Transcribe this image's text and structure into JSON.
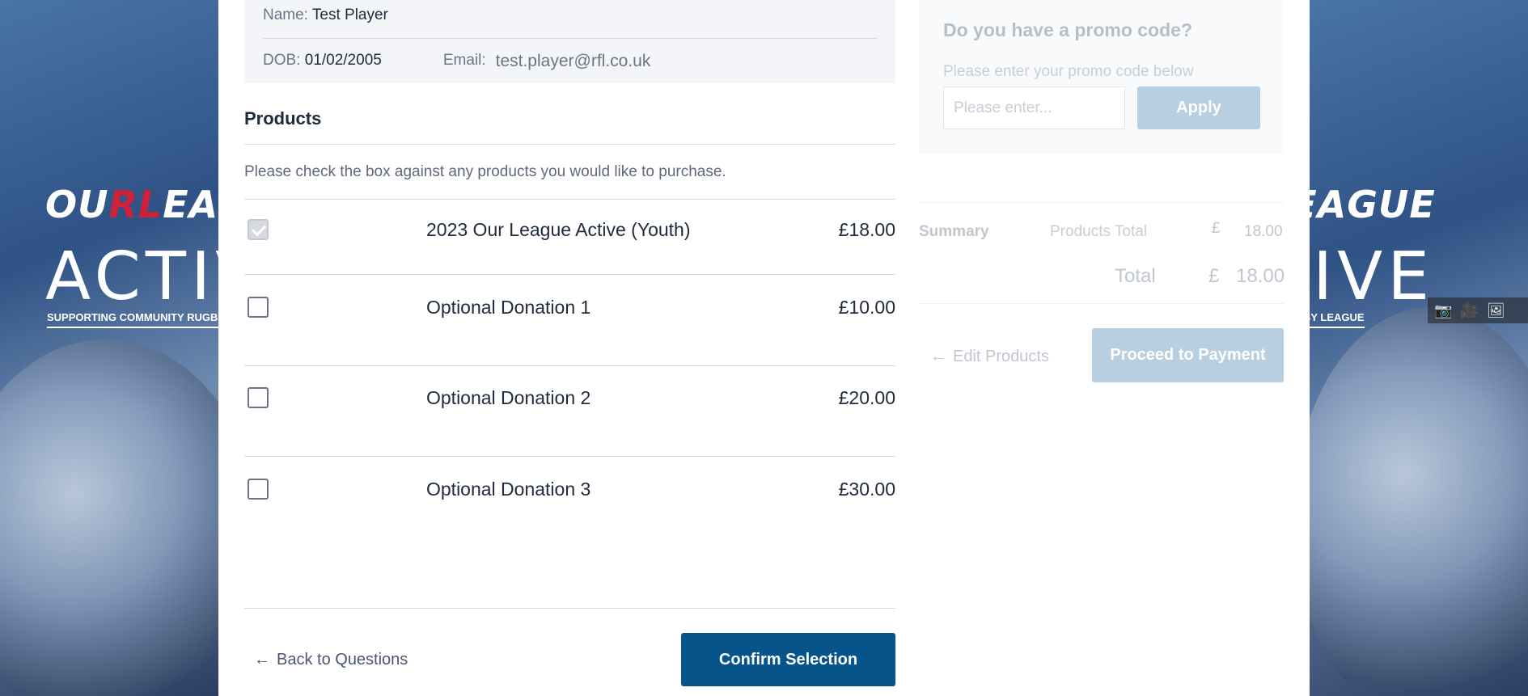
{
  "background": {
    "brand_line1_a": "OU",
    "brand_line1_b": "RL",
    "brand_line1_c": "EAGUE",
    "brand_line2": "ACTIVE",
    "brand_line3": "SUPPORTING COMMUNITY RUGBY LEAGUE"
  },
  "player": {
    "name_label": "Name:",
    "name_value": "Test Player",
    "dob_label": "DOB:",
    "dob_value": "01/02/2005",
    "email_label": "Email:",
    "email_value": "test.player@rfl.co.uk"
  },
  "products": {
    "title": "Products",
    "hint": "Please check the box against any products you would like to purchase.",
    "items": [
      {
        "name": "2023 Our League Active (Youth)",
        "price": "£18.00",
        "checked": true,
        "disabled": true
      },
      {
        "name": "Optional Donation 1",
        "price": "£10.00",
        "checked": false,
        "disabled": false
      },
      {
        "name": "Optional Donation 2",
        "price": "£20.00",
        "checked": false,
        "disabled": false
      },
      {
        "name": "Optional Donation 3",
        "price": "£30.00",
        "checked": false,
        "disabled": false
      }
    ]
  },
  "actions": {
    "back_label": "Back to Questions",
    "confirm_label": "Confirm Selection"
  },
  "promo": {
    "title": "Do you have a promo code?",
    "hint": "Please enter your promo code below",
    "placeholder": "Please enter...",
    "value": "",
    "apply_label": "Apply"
  },
  "summary": {
    "label": "Summary",
    "products_total_label": "Products Total",
    "currency": "£",
    "products_total_value": "18.00",
    "total_label": "Total",
    "total_value": "18.00",
    "edit_label": "Edit Products",
    "proceed_label": "Proceed to Payment"
  },
  "colors": {
    "primary_button": "#07548a",
    "disabled_button": "#b7cfe0",
    "brand_red": "#d0213a"
  }
}
